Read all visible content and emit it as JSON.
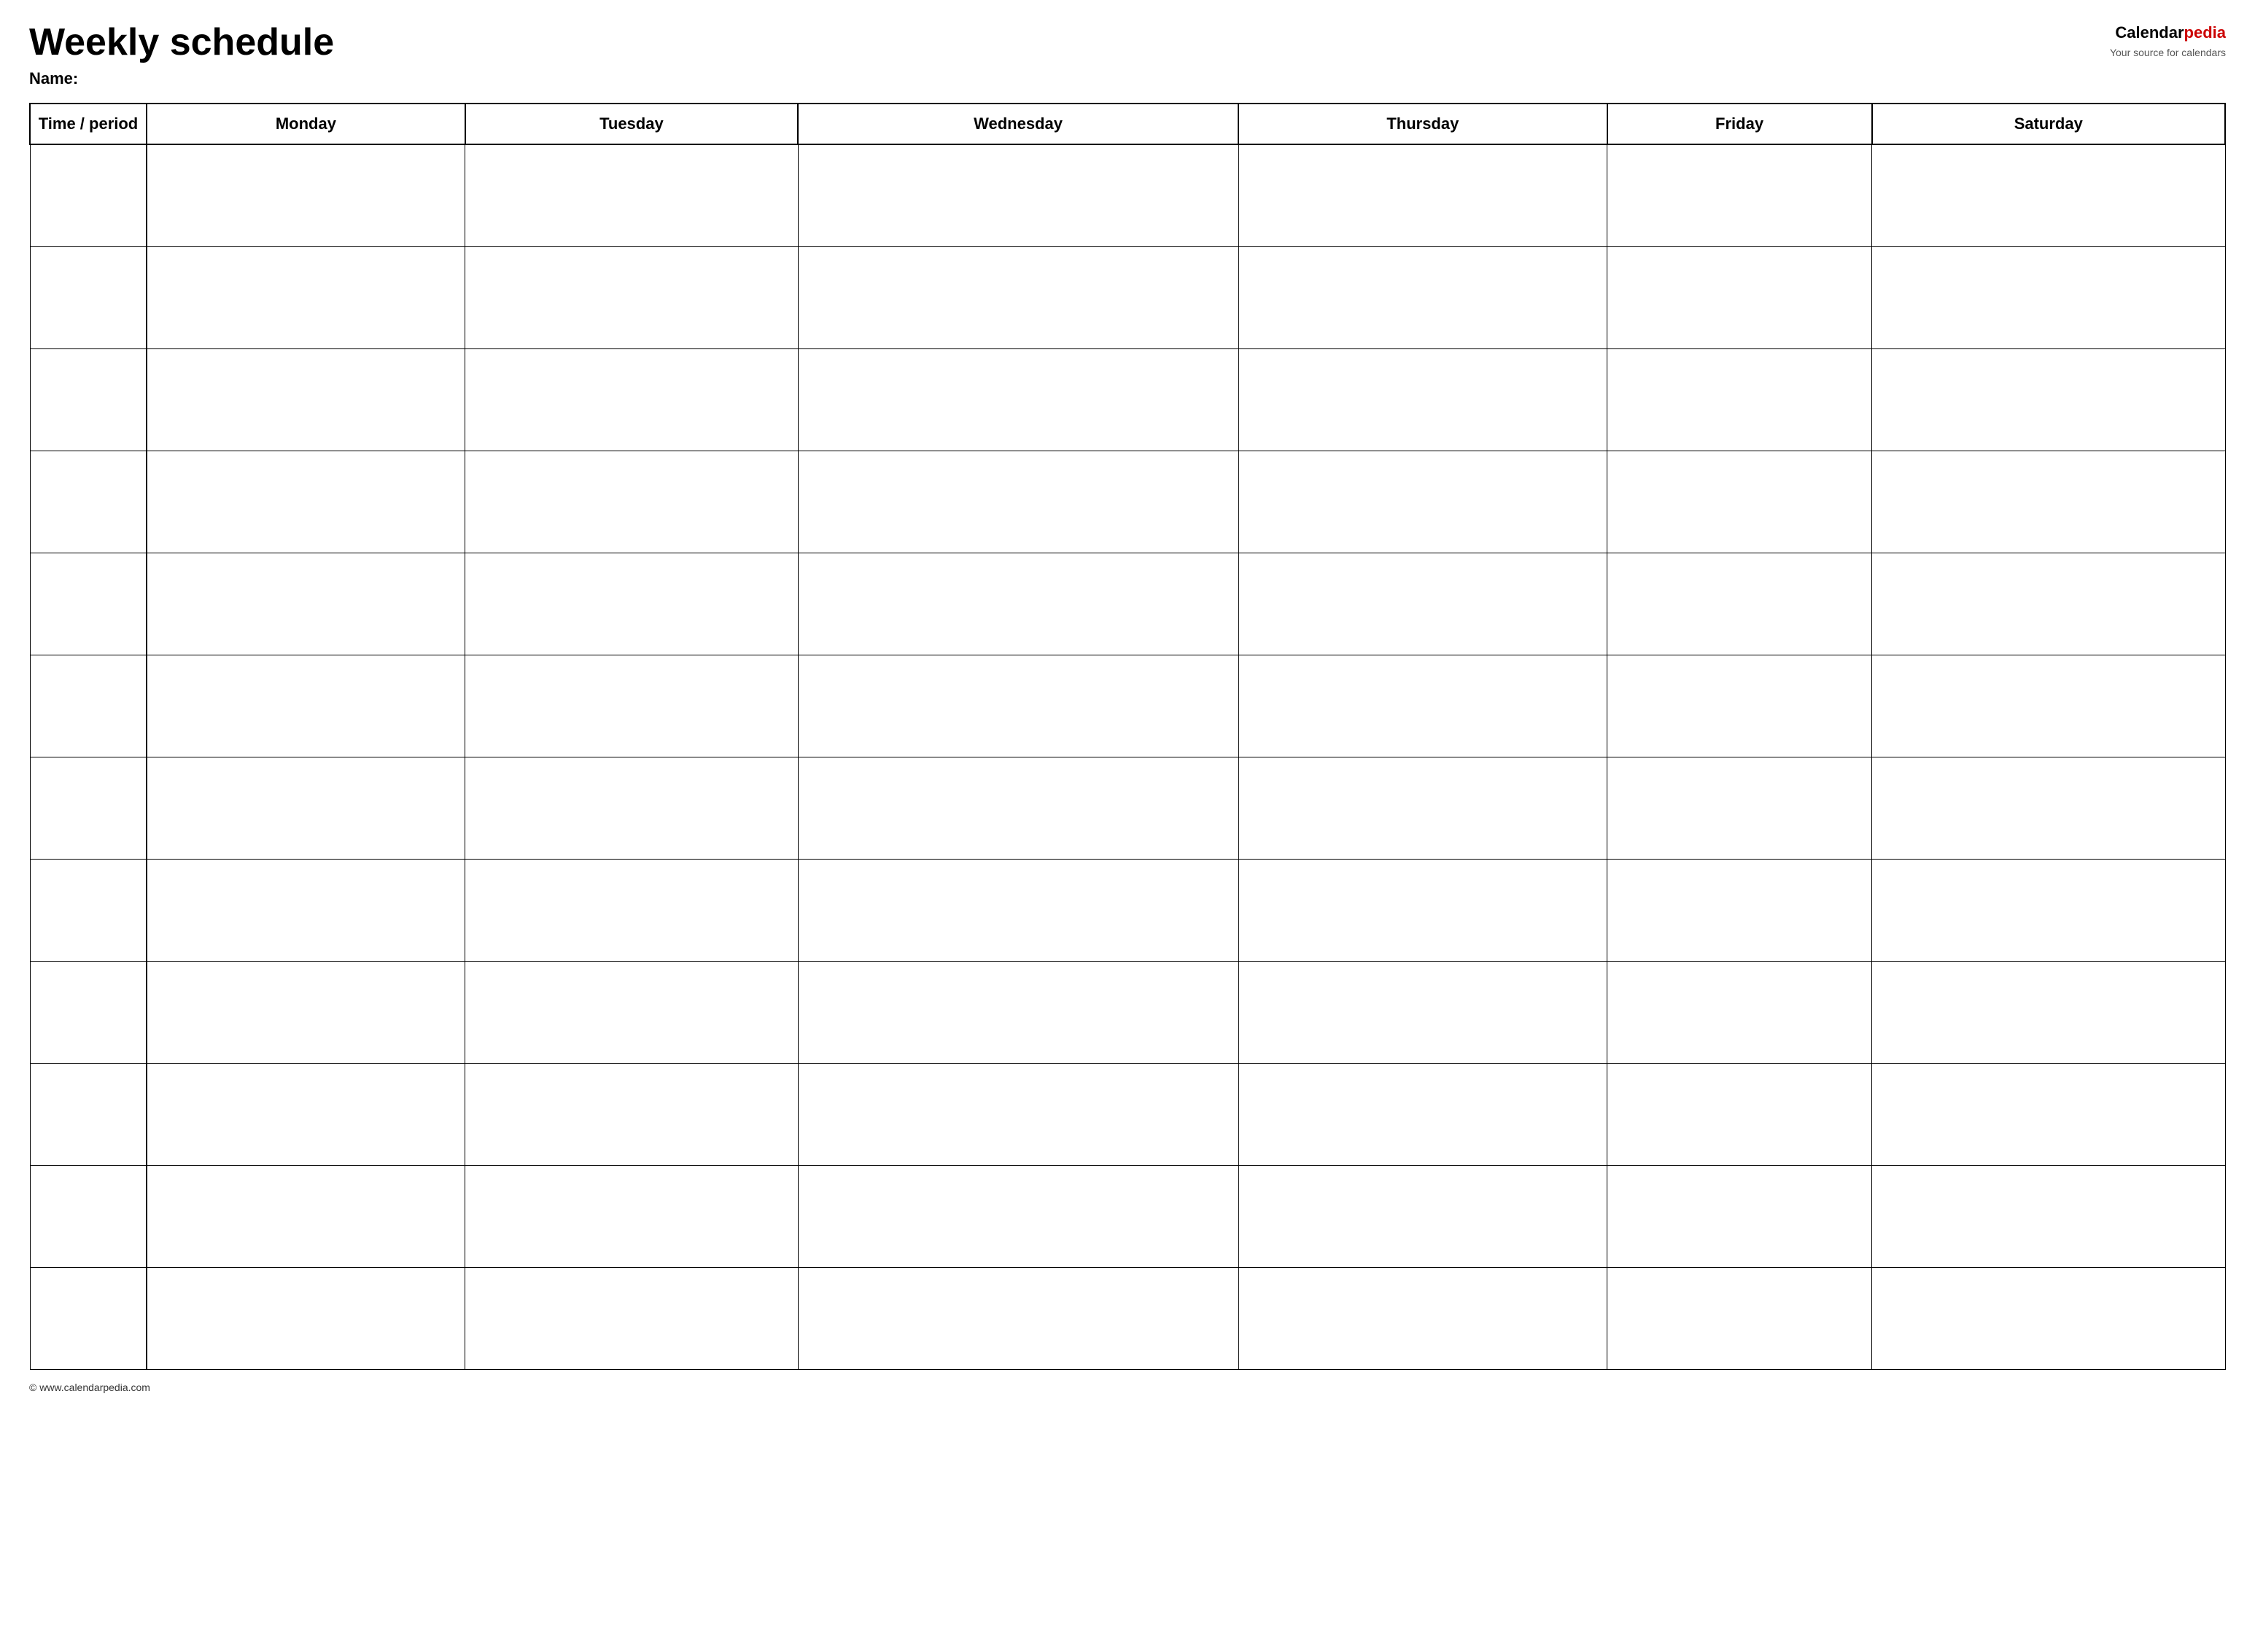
{
  "header": {
    "title": "Weekly schedule",
    "name_label": "Name:",
    "logo": {
      "calendar_text": "Calendar",
      "pedia_text": "pedia",
      "tagline": "Your source for calendars"
    }
  },
  "table": {
    "columns": [
      {
        "key": "time",
        "label": "Time / period"
      },
      {
        "key": "monday",
        "label": "Monday"
      },
      {
        "key": "tuesday",
        "label": "Tuesday"
      },
      {
        "key": "wednesday",
        "label": "Wednesday"
      },
      {
        "key": "thursday",
        "label": "Thursday"
      },
      {
        "key": "friday",
        "label": "Friday"
      },
      {
        "key": "saturday",
        "label": "Saturday"
      }
    ],
    "row_count": 12
  },
  "footer": {
    "copyright": "© www.calendarpedia.com"
  }
}
